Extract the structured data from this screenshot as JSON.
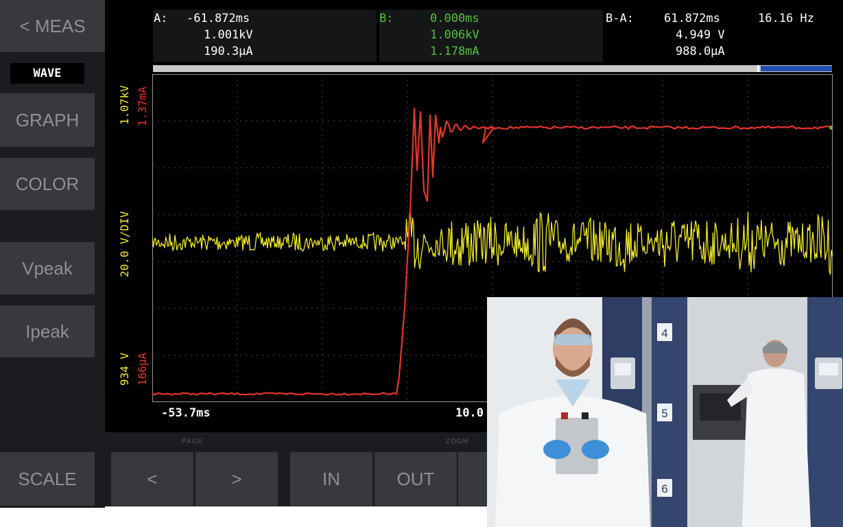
{
  "sidebar": {
    "meas_label": "< MEAS",
    "mode_label": "WAVE",
    "graph_label": "GRAPH",
    "color_label": "COLOR",
    "vpeak_label": "Vpeak",
    "ipeak_label": "Ipeak"
  },
  "bottom": {
    "scale_label": "SCALE",
    "page_group": "PAGE",
    "prev_label": "<",
    "next_label": ">",
    "zoom_group": "ZOOM",
    "in_label": "IN",
    "out_label": "OUT"
  },
  "readout": {
    "a": {
      "label": "A:",
      "time": "-61.872ms",
      "voltage": "1.001kV",
      "current": "190.3µA"
    },
    "b": {
      "label": "B:",
      "time": "0.000ms",
      "voltage": "1.006kV",
      "current": "1.178mA"
    },
    "ba": {
      "label": "B-A:",
      "time": "61.872ms",
      "freq": "16.16 Hz",
      "voltage": "4.949 V",
      "current": "988.0µA"
    }
  },
  "plot": {
    "v_top": "1.07kV",
    "i_top": "1.37mA",
    "v_scale": "20.0 V/DIV",
    "v_bottom": "934 V",
    "i_bottom": "166µA",
    "x_start": "-53.7ms",
    "x_center": "10.0"
  },
  "colors": {
    "voltage_trace": "#f5ec2a",
    "current_trace": "#e8352a",
    "cursor_b_text": "#55c13c",
    "position_bar": "#1f4fb0"
  }
}
